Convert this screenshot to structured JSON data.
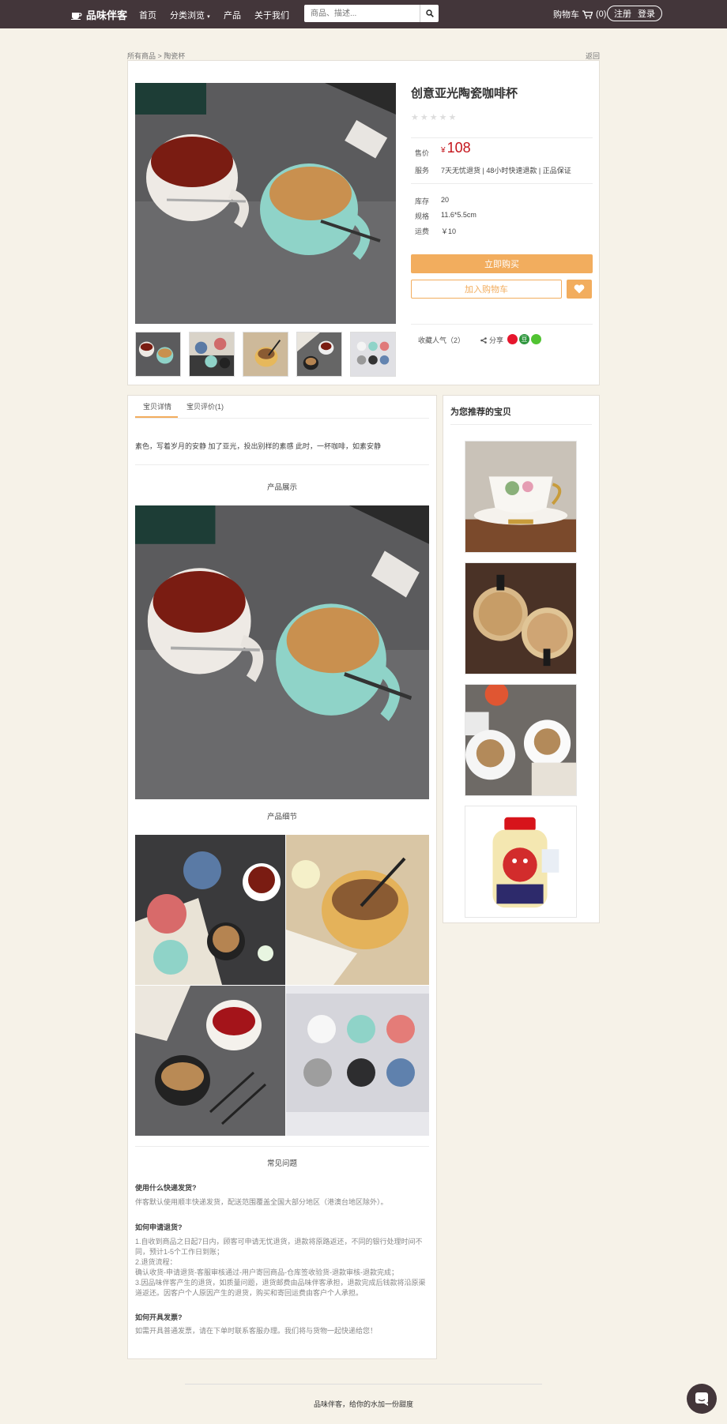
{
  "nav": {
    "brand": "品味伴客",
    "links": [
      "首页",
      "分类浏览",
      "产品",
      "关于我们"
    ],
    "search_placeholder": "商品、描述...",
    "cart_label": "购物车",
    "cart_count": "(0)",
    "register": "注册",
    "login": "登录"
  },
  "breadcrumb": "所有商品 > 陶瓷杯",
  "back_label": "返回",
  "product": {
    "title": "创意亚光陶瓷咖啡杯",
    "price_label": "售价",
    "currency": "¥",
    "price": "108",
    "service_label": "服务",
    "service": "7天无忧退货 | 48小时快速退款 | 正品保证",
    "stock_label": "库存",
    "stock": "20",
    "spec_label": "规格",
    "spec": "11.6*5.5cm",
    "shipping_label": "运费",
    "shipping": "￥10",
    "buy_label": "立即购买",
    "cart_label": "加入购物车",
    "fav_label": "收藏人气（2）",
    "share_label": "分享",
    "rating": 0,
    "stars_total": 5
  },
  "tabs": [
    "宝贝详情",
    "宝贝评价(1)"
  ],
  "description": "素色，写着岁月的安静 加了亚光，投出别样的素感 此时，一杯咖啡，如素安静",
  "sections": {
    "display": "产品展示",
    "detail": "产品细节",
    "faq": "常见问题"
  },
  "faq": [
    {
      "q": "使用什么快递发货?",
      "a": [
        "伴客默认使用顺丰快递发货，配送范围覆盖全国大部分地区（港澳台地区除外）。"
      ]
    },
    {
      "q": "如何申请退货?",
      "a": [
        "1.自收到商品之日起7日内，顾客可申请无忧退货，退款将原路返还，不同的银行处理时间不同，预计1-5个工作日到账；",
        "2.退货流程：",
        "确认收货-申请退货-客服审核通过-用户寄回商品-仓库签收验货-退款审核-退款完成；",
        "3.因品味伴客产生的退货，如质量问题，退货邮费由品味伴客承担，退款完成后钱款将沿原渠道返还。因客户个人原因产生的退货，购买和寄回运费由客户个人承担。"
      ]
    },
    {
      "q": "如何开具发票?",
      "a": [
        "如需开具普通发票，请在下单时联系客服办理。我们将与货物一起快递给您！"
      ]
    }
  ],
  "recommend_title": "为您推荐的宝贝",
  "footer": "品味伴客，给你的水加一份甜度",
  "colors": {
    "nav_bg": "#43363a",
    "accent": "#f2ad5e",
    "price": "#c4141b",
    "page_bg": "#f6f2e8"
  },
  "icons": [
    "coffee-cup-icon",
    "caret-down-icon",
    "search-icon",
    "cart-icon",
    "heart-icon",
    "share-icon",
    "weibo-icon",
    "douban-icon",
    "wechat-icon",
    "chat-icon"
  ]
}
